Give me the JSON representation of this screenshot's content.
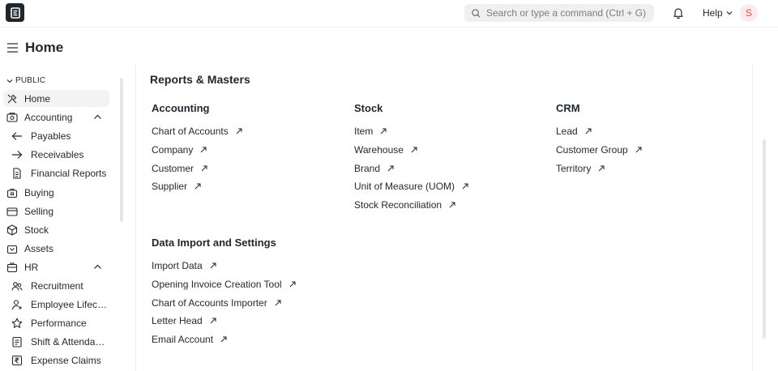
{
  "navbar": {
    "logo_letter": "E",
    "search_placeholder": "Search or type a command (Ctrl + G)",
    "help_label": "Help",
    "avatar_letter": "S"
  },
  "page": {
    "title": "Home"
  },
  "sidebar": {
    "section_label": "PUBLIC",
    "items": [
      {
        "label": "Home",
        "icon": "tools-icon",
        "active": true
      },
      {
        "label": "Accounting",
        "icon": "accounting-icon",
        "expanded": true
      },
      {
        "label": "Payables",
        "icon": "arrow-left-icon",
        "sub": true
      },
      {
        "label": "Receivables",
        "icon": "arrow-right-icon",
        "sub": true
      },
      {
        "label": "Financial Reports",
        "icon": "file-icon",
        "sub": true
      },
      {
        "label": "Buying",
        "icon": "bag-icon"
      },
      {
        "label": "Selling",
        "icon": "wallet-icon"
      },
      {
        "label": "Stock",
        "icon": "box-icon"
      },
      {
        "label": "Assets",
        "icon": "briefcase-icon"
      },
      {
        "label": "HR",
        "icon": "hr-icon",
        "expanded": true
      },
      {
        "label": "Recruitment",
        "icon": "users-icon",
        "sub": true
      },
      {
        "label": "Employee Lifecycle",
        "icon": "user-plus-icon",
        "sub": true
      },
      {
        "label": "Performance",
        "icon": "star-icon",
        "sub": true
      },
      {
        "label": "Shift & Attendance",
        "icon": "clipboard-icon",
        "sub": true
      },
      {
        "label": "Expense Claims",
        "icon": "rupee-icon",
        "sub": true
      }
    ]
  },
  "main": {
    "card_title": "Reports & Masters",
    "groups": [
      {
        "title": "Accounting",
        "links": [
          "Chart of Accounts",
          "Company",
          "Customer",
          "Supplier"
        ]
      },
      {
        "title": "Stock",
        "links": [
          "Item",
          "Warehouse",
          "Brand",
          "Unit of Measure (UOM)",
          "Stock Reconciliation"
        ]
      },
      {
        "title": "CRM",
        "links": [
          "Lead",
          "Customer Group",
          "Territory"
        ]
      },
      {
        "title": "Data Import and Settings",
        "links": [
          "Import Data",
          "Opening Invoice Creation Tool",
          "Chart of Accounts Importer",
          "Letter Head",
          "Email Account"
        ]
      }
    ]
  }
}
